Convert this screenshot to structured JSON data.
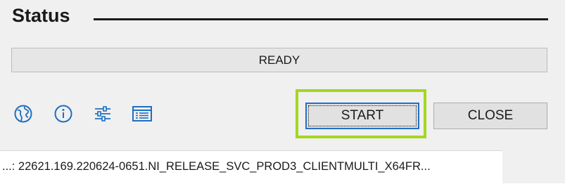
{
  "section": {
    "title": "Status"
  },
  "progress": {
    "text": "READY",
    "fraction": 0
  },
  "toolbar": {
    "icons": [
      {
        "name": "globe-icon"
      },
      {
        "name": "info-icon"
      },
      {
        "name": "settings-sliders-icon"
      },
      {
        "name": "table-icon"
      }
    ]
  },
  "buttons": {
    "start_label": "START",
    "close_label": "CLOSE"
  },
  "colors": {
    "accent": "#2470c6",
    "highlight": "#a4d71e",
    "icon": "#1e6fc2"
  },
  "footer": {
    "build_string": "...: 22621.169.220624-0651.NI_RELEASE_SVC_PROD3_CLIENTMULTI_X64FR..."
  }
}
